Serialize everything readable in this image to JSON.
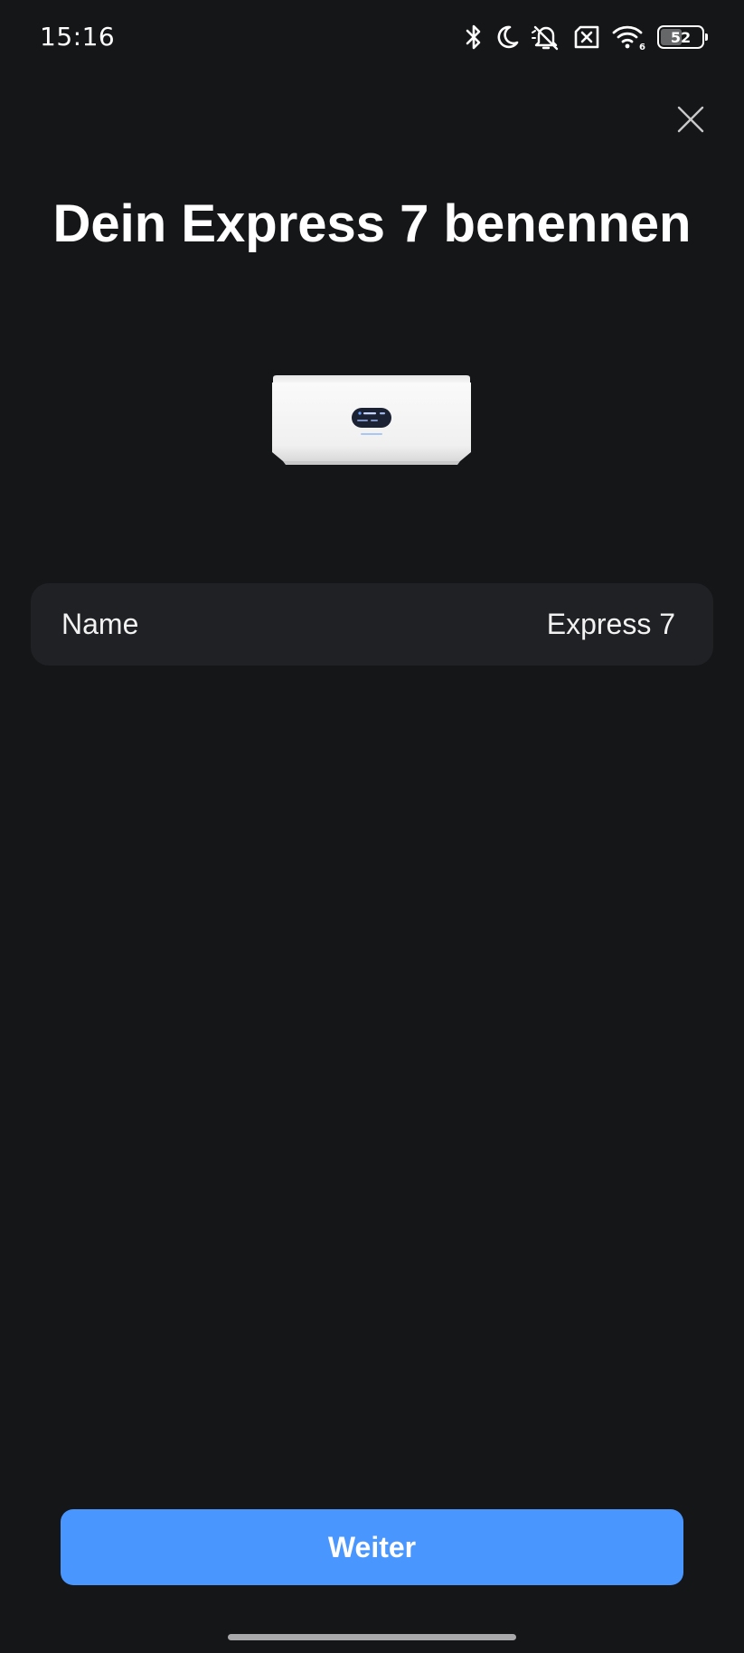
{
  "status_bar": {
    "time": "15:16",
    "battery_level": "52",
    "battery_fraction": 0.52,
    "icons": [
      "bluetooth-icon",
      "do-not-disturb-moon-icon",
      "bell-off-icon",
      "no-sim-icon",
      "wifi-6-icon",
      "battery-icon"
    ]
  },
  "header": {
    "title": "Dein Express 7 benennen",
    "close_icon": "close-icon"
  },
  "device": {
    "image_icon": "device-image",
    "screen_text_line1": "UniFi",
    "screen_text_line2": "Express 7"
  },
  "name_field": {
    "label": "Name",
    "value": "Express 7"
  },
  "footer": {
    "continue_label": "Weiter"
  },
  "colors": {
    "background": "#151618",
    "card": "#202124",
    "accent": "#4a96ff",
    "text": "#ffffff"
  }
}
